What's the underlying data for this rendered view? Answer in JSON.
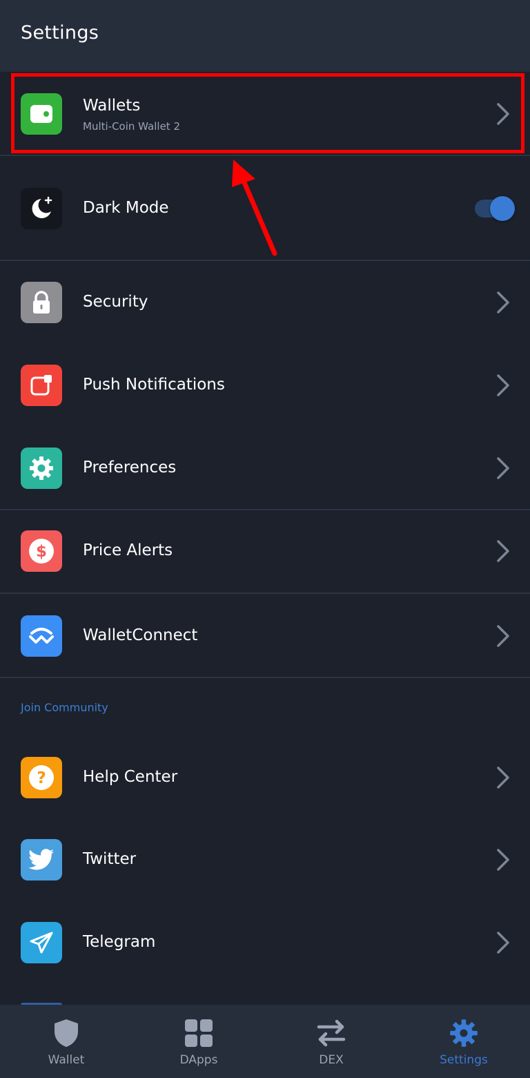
{
  "header": {
    "title": "Settings"
  },
  "wallets": {
    "label": "Wallets",
    "subtitle": "Multi-Coin Wallet 2",
    "color": "#34b33c"
  },
  "dark_mode": {
    "label": "Dark Mode",
    "enabled": true
  },
  "rows": [
    {
      "key": "security",
      "label": "Security",
      "icon": "lock-icon",
      "color": "#8e8e93"
    },
    {
      "key": "push",
      "label": "Push Notifications",
      "icon": "notification-icon",
      "color": "#f2433a"
    },
    {
      "key": "preferences",
      "label": "Preferences",
      "icon": "gear-icon",
      "color": "#2bb59d"
    },
    {
      "key": "price-alerts",
      "label": "Price Alerts",
      "icon": "dollar-icon",
      "color": "#f35b5b"
    },
    {
      "key": "walletconnect",
      "label": "WalletConnect",
      "icon": "walletconnect-icon",
      "color": "#3b8ef3"
    }
  ],
  "community": {
    "section_label": "Join Community",
    "rows": [
      {
        "key": "help-center",
        "label": "Help Center",
        "icon": "question-icon",
        "color": "#f79a0b"
      },
      {
        "key": "twitter",
        "label": "Twitter",
        "icon": "twitter-bird-icon",
        "color": "#4a9fde"
      },
      {
        "key": "telegram",
        "label": "Telegram",
        "icon": "paper-plane-icon",
        "color": "#2aa5e0"
      }
    ]
  },
  "tabbar": {
    "active": "Settings",
    "tabs": [
      {
        "label": "Wallet",
        "icon": "shield-icon"
      },
      {
        "label": "DApps",
        "icon": "grid-icon"
      },
      {
        "label": "DEX",
        "icon": "swap-arrows-icon"
      },
      {
        "label": "Settings",
        "icon": "gear-icon"
      }
    ]
  },
  "colors": {
    "accent": "#3a7bd5",
    "highlight": "#ff0000",
    "background": "#1c212c",
    "header": "#262d3b"
  }
}
